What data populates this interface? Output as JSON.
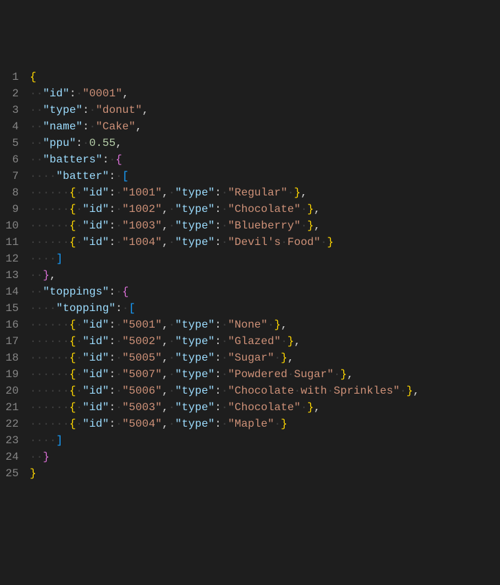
{
  "total_lines": 25,
  "colors": {
    "background": "#1e1e1e",
    "gutter_text": "#858585",
    "default_text": "#d4d4d4",
    "brace_level1": "#ffd700",
    "brace_level2": "#da70d6",
    "brace_level3": "#179fff",
    "property_key": "#9cdcfe",
    "string_value": "#ce9178",
    "number_value": "#b5cea8",
    "whitespace_dot": "#404040"
  },
  "json_document": {
    "id": "0001",
    "type": "donut",
    "name": "Cake",
    "ppu": 0.55,
    "batters": {
      "batter": [
        {
          "id": "1001",
          "type": "Regular"
        },
        {
          "id": "1002",
          "type": "Chocolate"
        },
        {
          "id": "1003",
          "type": "Blueberry"
        },
        {
          "id": "1004",
          "type": "Devil's Food"
        }
      ]
    },
    "toppings": {
      "topping": [
        {
          "id": "5001",
          "type": "None"
        },
        {
          "id": "5002",
          "type": "Glazed"
        },
        {
          "id": "5005",
          "type": "Sugar"
        },
        {
          "id": "5007",
          "type": "Powdered Sugar"
        },
        {
          "id": "5006",
          "type": "Chocolate with Sprinkles"
        },
        {
          "id": "5003",
          "type": "Chocolate"
        },
        {
          "id": "5004",
          "type": "Maple"
        }
      ]
    }
  },
  "lines": [
    {
      "n": 1,
      "indent": 0,
      "tokens": [
        {
          "t": "{",
          "c": "brace"
        }
      ]
    },
    {
      "n": 2,
      "indent": 2,
      "tokens": [
        {
          "t": "\"id\"",
          "c": "key"
        },
        {
          "t": ": ",
          "c": "punc"
        },
        {
          "t": "\"0001\"",
          "c": "str"
        },
        {
          "t": ",",
          "c": "punc"
        }
      ]
    },
    {
      "n": 3,
      "indent": 2,
      "tokens": [
        {
          "t": "\"type\"",
          "c": "key"
        },
        {
          "t": ": ",
          "c": "punc"
        },
        {
          "t": "\"donut\"",
          "c": "str"
        },
        {
          "t": ",",
          "c": "punc"
        }
      ]
    },
    {
      "n": 4,
      "indent": 2,
      "tokens": [
        {
          "t": "\"name\"",
          "c": "key"
        },
        {
          "t": ": ",
          "c": "punc"
        },
        {
          "t": "\"Cake\"",
          "c": "str"
        },
        {
          "t": ",",
          "c": "punc"
        }
      ]
    },
    {
      "n": 5,
      "indent": 2,
      "tokens": [
        {
          "t": "\"ppu\"",
          "c": "key"
        },
        {
          "t": ": ",
          "c": "punc"
        },
        {
          "t": "0.55",
          "c": "num"
        },
        {
          "t": ",",
          "c": "punc"
        }
      ]
    },
    {
      "n": 6,
      "indent": 2,
      "tokens": [
        {
          "t": "\"batters\"",
          "c": "key"
        },
        {
          "t": ": ",
          "c": "punc"
        },
        {
          "t": "{",
          "c": "brace2"
        }
      ]
    },
    {
      "n": 7,
      "indent": 4,
      "tokens": [
        {
          "t": "\"batter\"",
          "c": "key"
        },
        {
          "t": ": ",
          "c": "punc"
        },
        {
          "t": "[",
          "c": "brace3"
        }
      ]
    },
    {
      "n": 8,
      "indent": 6,
      "tokens": [
        {
          "t": "{",
          "c": "brace"
        },
        {
          "t": " ",
          "c": "ws"
        },
        {
          "t": "\"id\"",
          "c": "key"
        },
        {
          "t": ": ",
          "c": "punc"
        },
        {
          "t": "\"1001\"",
          "c": "str"
        },
        {
          "t": ", ",
          "c": "punc"
        },
        {
          "t": "\"type\"",
          "c": "key"
        },
        {
          "t": ": ",
          "c": "punc"
        },
        {
          "t": "\"Regular\"",
          "c": "str"
        },
        {
          "t": " ",
          "c": "ws"
        },
        {
          "t": "}",
          "c": "brace"
        },
        {
          "t": ",",
          "c": "punc"
        }
      ]
    },
    {
      "n": 9,
      "indent": 6,
      "tokens": [
        {
          "t": "{",
          "c": "brace"
        },
        {
          "t": " ",
          "c": "ws"
        },
        {
          "t": "\"id\"",
          "c": "key"
        },
        {
          "t": ": ",
          "c": "punc"
        },
        {
          "t": "\"1002\"",
          "c": "str"
        },
        {
          "t": ", ",
          "c": "punc"
        },
        {
          "t": "\"type\"",
          "c": "key"
        },
        {
          "t": ": ",
          "c": "punc"
        },
        {
          "t": "\"Chocolate\"",
          "c": "str"
        },
        {
          "t": " ",
          "c": "ws"
        },
        {
          "t": "}",
          "c": "brace"
        },
        {
          "t": ",",
          "c": "punc"
        }
      ]
    },
    {
      "n": 10,
      "indent": 6,
      "tokens": [
        {
          "t": "{",
          "c": "brace"
        },
        {
          "t": " ",
          "c": "ws"
        },
        {
          "t": "\"id\"",
          "c": "key"
        },
        {
          "t": ": ",
          "c": "punc"
        },
        {
          "t": "\"1003\"",
          "c": "str"
        },
        {
          "t": ", ",
          "c": "punc"
        },
        {
          "t": "\"type\"",
          "c": "key"
        },
        {
          "t": ": ",
          "c": "punc"
        },
        {
          "t": "\"Blueberry\"",
          "c": "str"
        },
        {
          "t": " ",
          "c": "ws"
        },
        {
          "t": "}",
          "c": "brace"
        },
        {
          "t": ",",
          "c": "punc"
        }
      ]
    },
    {
      "n": 11,
      "indent": 6,
      "tokens": [
        {
          "t": "{",
          "c": "brace"
        },
        {
          "t": " ",
          "c": "ws"
        },
        {
          "t": "\"id\"",
          "c": "key"
        },
        {
          "t": ": ",
          "c": "punc"
        },
        {
          "t": "\"1004\"",
          "c": "str"
        },
        {
          "t": ", ",
          "c": "punc"
        },
        {
          "t": "\"type\"",
          "c": "key"
        },
        {
          "t": ": ",
          "c": "punc"
        },
        {
          "t": "\"Devil's Food\"",
          "c": "str"
        },
        {
          "t": " ",
          "c": "ws"
        },
        {
          "t": "}",
          "c": "brace"
        }
      ]
    },
    {
      "n": 12,
      "indent": 4,
      "tokens": [
        {
          "t": "]",
          "c": "brace3"
        }
      ]
    },
    {
      "n": 13,
      "indent": 2,
      "tokens": [
        {
          "t": "}",
          "c": "brace2"
        },
        {
          "t": ",",
          "c": "punc"
        }
      ]
    },
    {
      "n": 14,
      "indent": 2,
      "tokens": [
        {
          "t": "\"toppings\"",
          "c": "key"
        },
        {
          "t": ": ",
          "c": "punc"
        },
        {
          "t": "{",
          "c": "brace2"
        }
      ]
    },
    {
      "n": 15,
      "indent": 4,
      "tokens": [
        {
          "t": "\"topping\"",
          "c": "key"
        },
        {
          "t": ": ",
          "c": "punc"
        },
        {
          "t": "[",
          "c": "brace3"
        }
      ]
    },
    {
      "n": 16,
      "indent": 6,
      "tokens": [
        {
          "t": "{",
          "c": "brace"
        },
        {
          "t": " ",
          "c": "ws"
        },
        {
          "t": "\"id\"",
          "c": "key"
        },
        {
          "t": ": ",
          "c": "punc"
        },
        {
          "t": "\"5001\"",
          "c": "str"
        },
        {
          "t": ", ",
          "c": "punc"
        },
        {
          "t": "\"type\"",
          "c": "key"
        },
        {
          "t": ": ",
          "c": "punc"
        },
        {
          "t": "\"None\"",
          "c": "str"
        },
        {
          "t": " ",
          "c": "ws"
        },
        {
          "t": "}",
          "c": "brace"
        },
        {
          "t": ",",
          "c": "punc"
        }
      ]
    },
    {
      "n": 17,
      "indent": 6,
      "tokens": [
        {
          "t": "{",
          "c": "brace"
        },
        {
          "t": " ",
          "c": "ws"
        },
        {
          "t": "\"id\"",
          "c": "key"
        },
        {
          "t": ": ",
          "c": "punc"
        },
        {
          "t": "\"5002\"",
          "c": "str"
        },
        {
          "t": ", ",
          "c": "punc"
        },
        {
          "t": "\"type\"",
          "c": "key"
        },
        {
          "t": ": ",
          "c": "punc"
        },
        {
          "t": "\"Glazed\"",
          "c": "str"
        },
        {
          "t": " ",
          "c": "ws"
        },
        {
          "t": "}",
          "c": "brace"
        },
        {
          "t": ",",
          "c": "punc"
        }
      ]
    },
    {
      "n": 18,
      "indent": 6,
      "tokens": [
        {
          "t": "{",
          "c": "brace"
        },
        {
          "t": " ",
          "c": "ws"
        },
        {
          "t": "\"id\"",
          "c": "key"
        },
        {
          "t": ": ",
          "c": "punc"
        },
        {
          "t": "\"5005\"",
          "c": "str"
        },
        {
          "t": ", ",
          "c": "punc"
        },
        {
          "t": "\"type\"",
          "c": "key"
        },
        {
          "t": ": ",
          "c": "punc"
        },
        {
          "t": "\"Sugar\"",
          "c": "str"
        },
        {
          "t": " ",
          "c": "ws"
        },
        {
          "t": "}",
          "c": "brace"
        },
        {
          "t": ",",
          "c": "punc"
        }
      ]
    },
    {
      "n": 19,
      "indent": 6,
      "tokens": [
        {
          "t": "{",
          "c": "brace"
        },
        {
          "t": " ",
          "c": "ws"
        },
        {
          "t": "\"id\"",
          "c": "key"
        },
        {
          "t": ": ",
          "c": "punc"
        },
        {
          "t": "\"5007\"",
          "c": "str"
        },
        {
          "t": ", ",
          "c": "punc"
        },
        {
          "t": "\"type\"",
          "c": "key"
        },
        {
          "t": ": ",
          "c": "punc"
        },
        {
          "t": "\"Powdered Sugar\"",
          "c": "str"
        },
        {
          "t": " ",
          "c": "ws"
        },
        {
          "t": "}",
          "c": "brace"
        },
        {
          "t": ",",
          "c": "punc"
        }
      ]
    },
    {
      "n": 20,
      "indent": 6,
      "tokens": [
        {
          "t": "{",
          "c": "brace"
        },
        {
          "t": " ",
          "c": "ws"
        },
        {
          "t": "\"id\"",
          "c": "key"
        },
        {
          "t": ": ",
          "c": "punc"
        },
        {
          "t": "\"5006\"",
          "c": "str"
        },
        {
          "t": ", ",
          "c": "punc"
        },
        {
          "t": "\"type\"",
          "c": "key"
        },
        {
          "t": ": ",
          "c": "punc"
        },
        {
          "t": "\"Chocolate with Sprinkles\"",
          "c": "str"
        },
        {
          "t": " ",
          "c": "ws"
        },
        {
          "t": "}",
          "c": "brace"
        },
        {
          "t": ",",
          "c": "punc"
        }
      ]
    },
    {
      "n": 21,
      "indent": 6,
      "tokens": [
        {
          "t": "{",
          "c": "brace"
        },
        {
          "t": " ",
          "c": "ws"
        },
        {
          "t": "\"id\"",
          "c": "key"
        },
        {
          "t": ": ",
          "c": "punc"
        },
        {
          "t": "\"5003\"",
          "c": "str"
        },
        {
          "t": ", ",
          "c": "punc"
        },
        {
          "t": "\"type\"",
          "c": "key"
        },
        {
          "t": ": ",
          "c": "punc"
        },
        {
          "t": "\"Chocolate\"",
          "c": "str"
        },
        {
          "t": " ",
          "c": "ws"
        },
        {
          "t": "}",
          "c": "brace"
        },
        {
          "t": ",",
          "c": "punc"
        }
      ]
    },
    {
      "n": 22,
      "indent": 6,
      "tokens": [
        {
          "t": "{",
          "c": "brace"
        },
        {
          "t": " ",
          "c": "ws"
        },
        {
          "t": "\"id\"",
          "c": "key"
        },
        {
          "t": ": ",
          "c": "punc"
        },
        {
          "t": "\"5004\"",
          "c": "str"
        },
        {
          "t": ", ",
          "c": "punc"
        },
        {
          "t": "\"type\"",
          "c": "key"
        },
        {
          "t": ": ",
          "c": "punc"
        },
        {
          "t": "\"Maple\"",
          "c": "str"
        },
        {
          "t": " ",
          "c": "ws"
        },
        {
          "t": "}",
          "c": "brace"
        }
      ]
    },
    {
      "n": 23,
      "indent": 4,
      "tokens": [
        {
          "t": "]",
          "c": "brace3"
        }
      ]
    },
    {
      "n": 24,
      "indent": 2,
      "tokens": [
        {
          "t": "}",
          "c": "brace2"
        }
      ]
    },
    {
      "n": 25,
      "indent": 0,
      "tokens": [
        {
          "t": "}",
          "c": "brace"
        }
      ]
    }
  ]
}
